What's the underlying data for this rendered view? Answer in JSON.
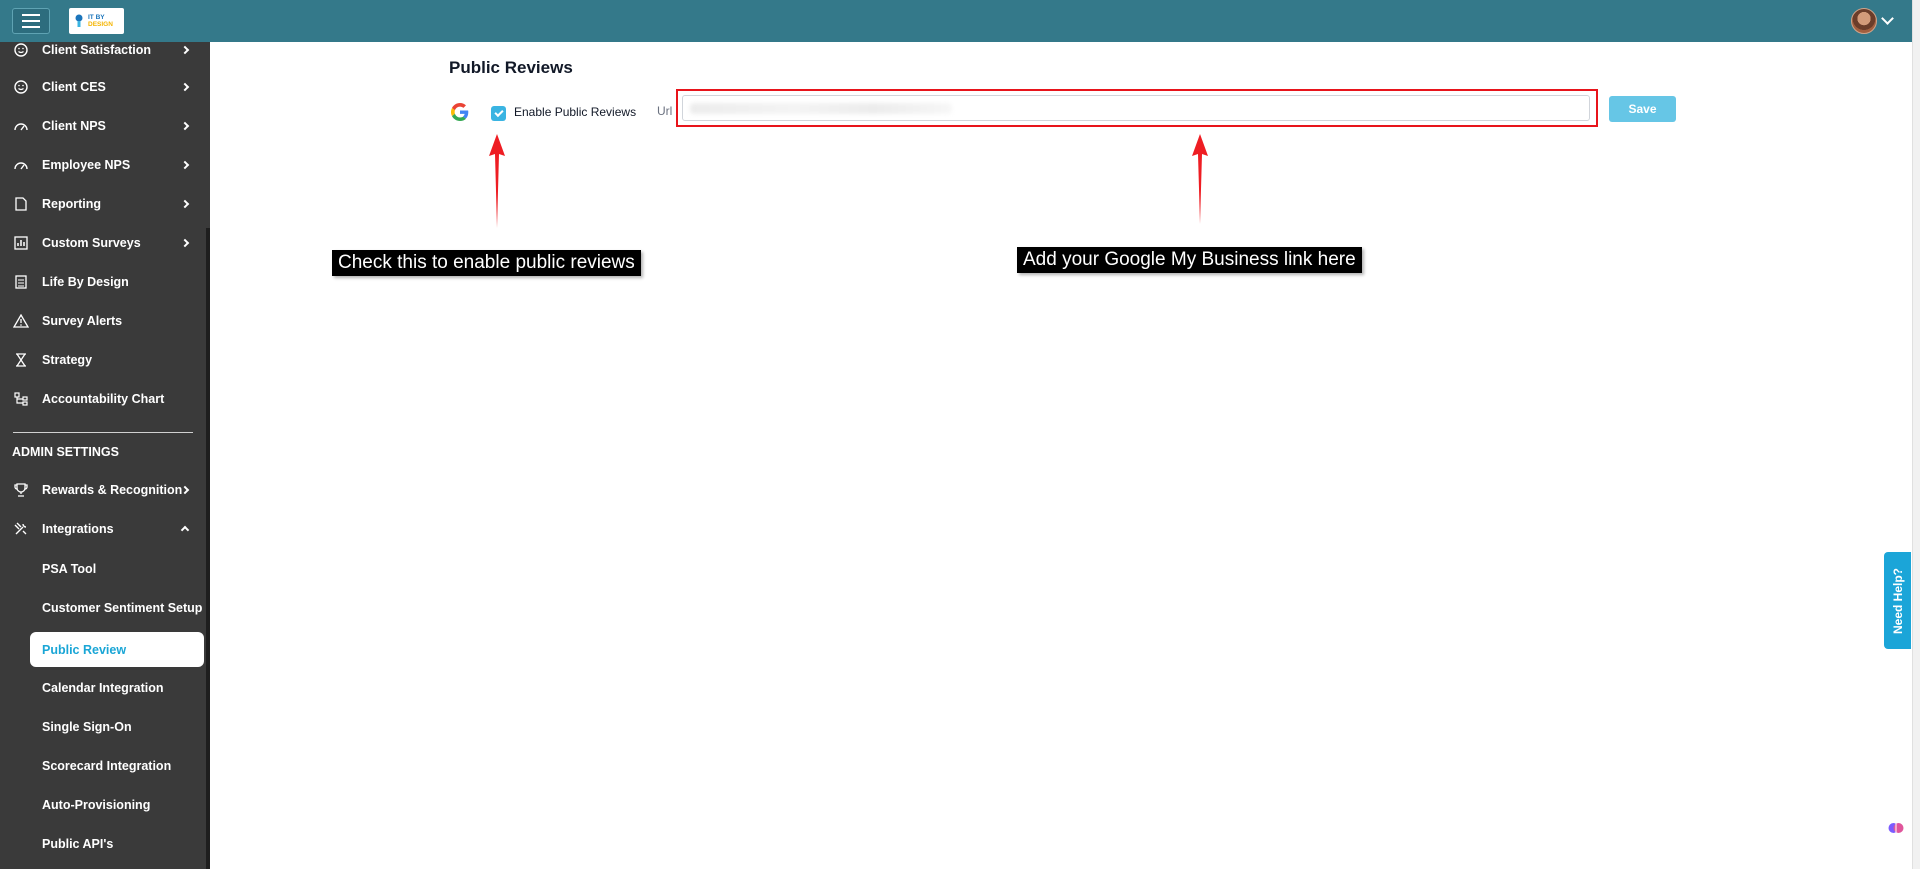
{
  "header": {
    "menu_icon": "hamburger-icon",
    "logo_text_line1": "IT BY",
    "logo_text_line2": "DESIGN",
    "profile_icon": "avatar"
  },
  "sidebar": {
    "items": [
      {
        "label": "Client Satisfaction",
        "icon": "smile-icon",
        "expandable": true
      },
      {
        "label": "Client CES",
        "icon": "smile-icon",
        "expandable": true
      },
      {
        "label": "Client NPS",
        "icon": "gauge-icon",
        "expandable": true
      },
      {
        "label": "Employee NPS",
        "icon": "gauge-icon",
        "expandable": true
      },
      {
        "label": "Reporting",
        "icon": "document-icon",
        "expandable": true
      },
      {
        "label": "Custom Surveys",
        "icon": "bar-chart-icon",
        "expandable": true
      },
      {
        "label": "Life By Design",
        "icon": "list-icon",
        "expandable": false
      },
      {
        "label": "Survey Alerts",
        "icon": "warning-icon",
        "expandable": false
      },
      {
        "label": "Strategy",
        "icon": "hourglass-icon",
        "expandable": false
      },
      {
        "label": "Accountability Chart",
        "icon": "org-chart-icon",
        "expandable": false
      }
    ],
    "admin_section_title": "ADMIN SETTINGS",
    "admin_items": [
      {
        "label": "Rewards & Recognition",
        "icon": "trophy-icon",
        "expandable": true
      },
      {
        "label": "Integrations",
        "icon": "tools-icon",
        "expanded": true
      }
    ],
    "integration_subitems": [
      "PSA Tool",
      "Customer Sentiment Setup",
      "Public Review",
      "Calendar Integration",
      "Single Sign-On",
      "Scorecard Integration",
      "Auto-Provisioning",
      "Public API's"
    ],
    "active_subitem": "Public Review"
  },
  "main": {
    "title": "Public Reviews",
    "google_icon": "google-icon",
    "checkbox_label": "Enable Public Reviews",
    "checkbox_checked": true,
    "url_label": "Url",
    "url_value": "",
    "save_label": "Save"
  },
  "annotations": {
    "checkbox_callout": "Check this to enable public reviews",
    "url_callout": "Add your Google My Business link here",
    "highlight_color": "#e8141b"
  },
  "help": {
    "label": "Need Help?"
  },
  "colors": {
    "topbar": "#34798a",
    "sidebar": "#3a3a3a",
    "accent": "#1aa6d6",
    "save_button": "#66c6e6"
  }
}
